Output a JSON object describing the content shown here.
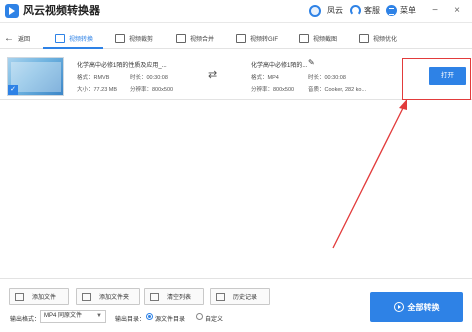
{
  "window": {
    "title": "风云视频转换器",
    "user_name": "凤云",
    "service_label": "客服",
    "menu_label": "菜单",
    "minimize": "−",
    "close": "×"
  },
  "toolbar": {
    "back_label": "返回",
    "tabs": [
      {
        "label": "视频转换",
        "icon": "video-convert-icon",
        "active": true
      },
      {
        "label": "视频裁剪",
        "icon": "crop-icon",
        "active": false
      },
      {
        "label": "视频合并",
        "icon": "merge-icon",
        "active": false
      },
      {
        "label": "视频转GIF",
        "icon": "gif-icon",
        "active": false
      },
      {
        "label": "视频截图",
        "icon": "screenshot-icon",
        "active": false
      },
      {
        "label": "视频优化",
        "icon": "optimize-icon",
        "active": false
      }
    ]
  },
  "file": {
    "source": {
      "name": "化学高中必修1陌的性质及应用_...",
      "format": "格式：RMVB",
      "duration": "时长：00:30:08",
      "size": "大小：77.23 MB",
      "resolution": "分辨率：800x500"
    },
    "output": {
      "name": "化学高中必修1陌的...",
      "format": "格式：MP4",
      "duration": "时长：00:30:08",
      "resolution": "分辨率：800x500",
      "quality": "音质：Cooker, 282 ko..."
    },
    "open_label": "打开"
  },
  "actions": {
    "add_file": "添加文件",
    "add_folder": "添加文件夹",
    "clear_list": "清空列表",
    "history": "历史记录"
  },
  "output_settings": {
    "format_label": "输出格式：",
    "format_value": "MP4 同原文件",
    "dir_label": "输出目录：",
    "dir_options": [
      {
        "label": "源文件目录",
        "selected": true
      },
      {
        "label": "自定义",
        "selected": false
      }
    ]
  },
  "convert_all_label": "全部转换",
  "colors": {
    "accent": "#2e82e6",
    "annotation": "#e23b3b"
  }
}
